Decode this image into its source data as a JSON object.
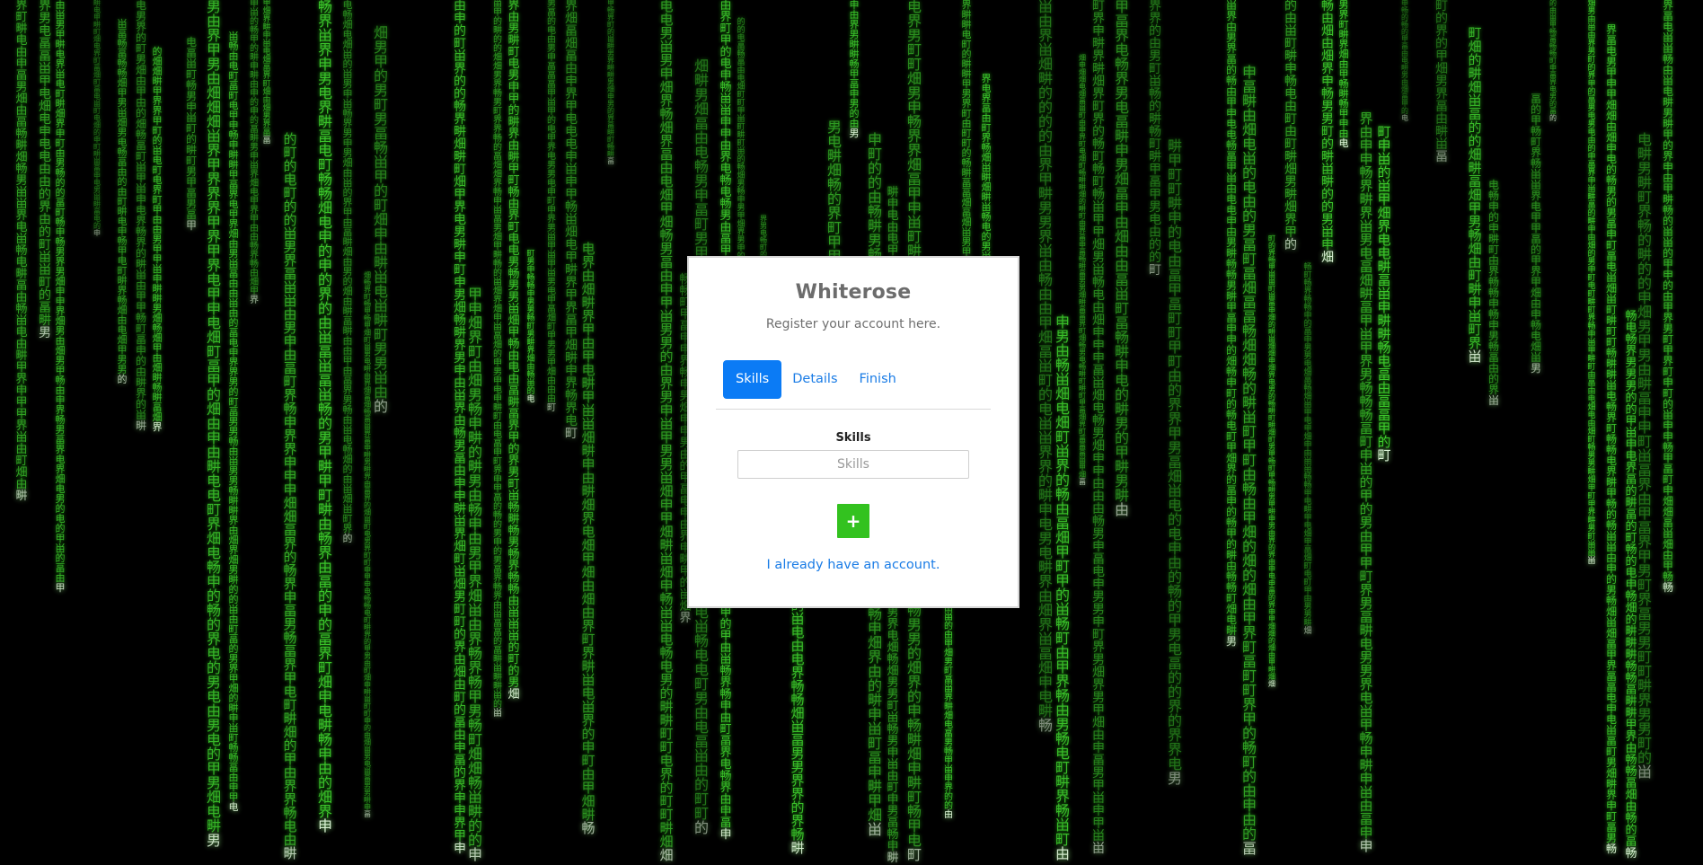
{
  "background": {
    "style": "matrix-digital-rain",
    "glyph_color": "#3fd12e",
    "head_glyph_color": "#e6ffe0",
    "glyphs": [
      "男",
      "界",
      "畅",
      "由",
      "甲",
      "电",
      "畑",
      "畊",
      "畐",
      "的",
      "申",
      "町",
      "畄"
    ]
  },
  "register_panel": {
    "title": "Whiterose",
    "subtitle": "Register your account here.",
    "tabs": [
      {
        "label": "Skills",
        "active": true
      },
      {
        "label": "Details",
        "active": false
      },
      {
        "label": "Finish",
        "active": false
      }
    ],
    "skills_field": {
      "label": "Skills",
      "placeholder": "Skills",
      "value": ""
    },
    "add_button": {
      "label": "+",
      "icon": "plus-icon",
      "color": "#33c21f"
    },
    "login_link": "I already have an account."
  },
  "colors": {
    "accent": "#0b7bf5",
    "link": "#1a7ce6",
    "success": "#33c21f"
  }
}
